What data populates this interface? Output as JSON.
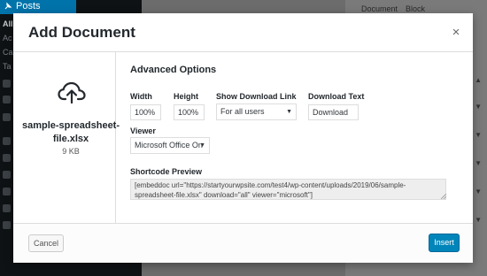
{
  "background": {
    "sidebar": {
      "posts_label": "Posts",
      "sub_items": [
        "All",
        "Ac",
        "Ca",
        "Ta"
      ]
    },
    "editor_tabs": [
      "Document",
      "Block"
    ]
  },
  "modal": {
    "title": "Add Document",
    "close_label": "×",
    "file": {
      "icon": "cloud-upload-icon",
      "name": "sample-spreadsheet-file.xlsx",
      "size": "9 KB"
    },
    "advanced_options": {
      "title": "Advanced Options",
      "width_label": "Width",
      "width_value": "100%",
      "height_label": "Height",
      "height_value": "100%",
      "download_link_label": "Show Download Link",
      "download_link_value": "For all users",
      "download_text_label": "Download Text",
      "download_text_value": "Download",
      "viewer_label": "Viewer",
      "viewer_value": "Microsoft Office On",
      "shortcode_label": "Shortcode Preview",
      "shortcode_value": "[embeddoc url=\"https://startyourwpsite.com/test4/wp-content/uploads/2019/06/sample-spreadsheet-file.xlsx\" download=\"all\" viewer=\"microsoft\"]"
    },
    "footer": {
      "cancel_label": "Cancel",
      "insert_label": "Insert"
    }
  },
  "colors": {
    "primary_button": "#0085ba",
    "admin_accent": "#0073aa",
    "sidebar_bg": "#0f1214"
  }
}
